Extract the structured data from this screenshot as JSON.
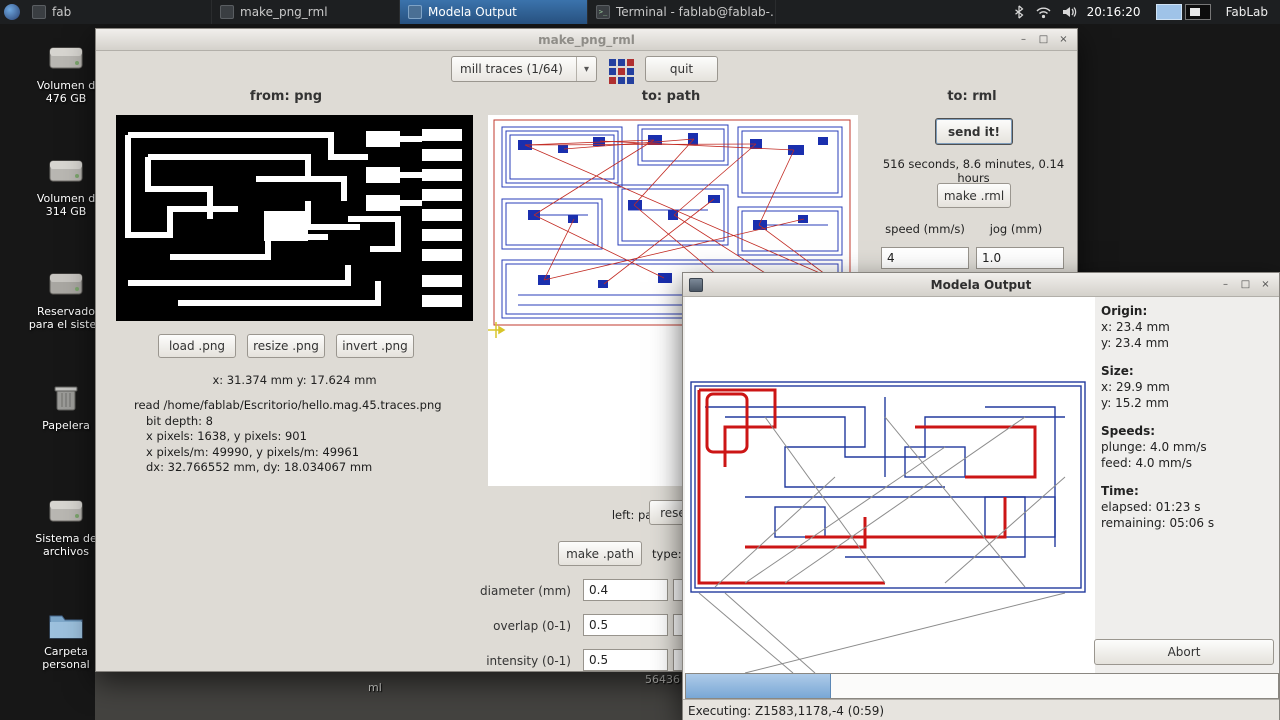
{
  "icons": {
    "minimize": "–",
    "maximize": "□",
    "close": "×",
    "dropdown_arrow": "▾",
    "terminal_glyph": ">_"
  },
  "colors": {
    "accent_blue": "#3465a4",
    "trace_blue": "#1f2fae",
    "trace_red": "#c22a22",
    "progress_fill": "#8db4dd"
  },
  "panel": {
    "tasks": [
      {
        "label": "fab"
      },
      {
        "label": "make_png_rml"
      },
      {
        "label": "Modela Output"
      },
      {
        "label": "Terminal - fablab@fablab-..."
      }
    ],
    "clock": "20:16:20",
    "workspace_label": "FabLab"
  },
  "desktop": {
    "icons": [
      {
        "line1": "Volumen d",
        "line2": "476 GB"
      },
      {
        "line1": "Volumen d",
        "line2": "314 GB"
      },
      {
        "line1": "Reservado",
        "line2": "para el sisten"
      },
      {
        "line1": "Papelera",
        "line2": ""
      },
      {
        "line1": "Sistema de",
        "line2": "archivos"
      },
      {
        "line1": "Carpeta",
        "line2": "personal"
      }
    ],
    "fragments": {
      "a": "ml",
      "b": "56436"
    }
  },
  "fab_window": {
    "title": "make_png_rml",
    "toolbar": {
      "process_select": "mill traces (1/64)",
      "quit": "quit"
    },
    "columns": {
      "png": "from: png",
      "path": "to: path",
      "rml": "to: rml"
    },
    "png_panel": {
      "load": "load .png",
      "resize": "resize .png",
      "invert": "invert .png",
      "coords": "x: 31.374 mm  y: 17.624 mm",
      "info": [
        "read /home/fablab/Escritorio/hello.mag.45.traces.png",
        "bit depth: 8",
        "x pixels: 1638, y pixels: 901",
        "x pixels/m: 49990, y pixels/m: 49961",
        "dx: 32.766552 mm, dy: 18.034067 mm"
      ]
    },
    "path_panel": {
      "hint": "left: pan, scroll: zoom",
      "reset_view": "reset view",
      "make_path": "make .path",
      "type_label": "type:",
      "fields": [
        {
          "label": "diameter (mm)",
          "value": "0.4"
        },
        {
          "label": "overlap (0-1)",
          "value": "0.5"
        },
        {
          "label": "intensity (0-1)",
          "value": "0.5"
        }
      ]
    },
    "rml_panel": {
      "send": "send it!",
      "time_estimate": "516 seconds, 8.6 minutes, 0.14 hours",
      "make_rml": "make .rml",
      "speed_label": "speed (mm/s)",
      "jog_label": "jog (mm)",
      "speed_value": "4",
      "jog_value": "1.0"
    }
  },
  "modela_window": {
    "title": "Modela Output",
    "info": {
      "origin_title": "Origin:",
      "origin_x": "x: 23.4 mm",
      "origin_y": "y: 23.4 mm",
      "size_title": "Size:",
      "size_x": "x: 29.9 mm",
      "size_y": "y: 15.2 mm",
      "speeds_title": "Speeds:",
      "plunge": "plunge: 4.0 mm/s",
      "feed": "feed: 4.0 mm/s",
      "time_title": "Time:",
      "elapsed": "elapsed: 01:23 s",
      "remaining": "remaining: 05:06 s"
    },
    "abort": "Abort",
    "progress_style": "width:24.5%",
    "status": "Executing: Z1583,1178,-4 (0:59)"
  }
}
